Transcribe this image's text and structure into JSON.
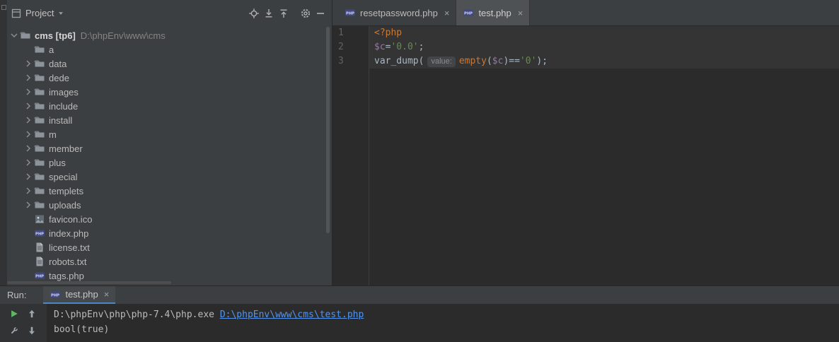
{
  "project_panel": {
    "title": "Project",
    "header_icons": [
      "locate-icon",
      "expand-all-icon",
      "collapse-all-icon",
      "settings-gear-icon",
      "hide-panel-icon"
    ],
    "tree": {
      "root": {
        "name": "cms [tp6]",
        "path": "D:\\phpEnv\\www\\cms"
      },
      "items": [
        {
          "label": "a",
          "type": "folder",
          "expandable": false
        },
        {
          "label": "data",
          "type": "folder",
          "expandable": true
        },
        {
          "label": "dede",
          "type": "folder",
          "expandable": true
        },
        {
          "label": "images",
          "type": "folder",
          "expandable": true
        },
        {
          "label": "include",
          "type": "folder",
          "expandable": true
        },
        {
          "label": "install",
          "type": "folder",
          "expandable": true
        },
        {
          "label": "m",
          "type": "folder",
          "expandable": true
        },
        {
          "label": "member",
          "type": "folder",
          "expandable": true
        },
        {
          "label": "plus",
          "type": "folder",
          "expandable": true
        },
        {
          "label": "special",
          "type": "folder",
          "expandable": true
        },
        {
          "label": "templets",
          "type": "folder",
          "expandable": true
        },
        {
          "label": "uploads",
          "type": "folder",
          "expandable": true
        },
        {
          "label": "favicon.ico",
          "type": "image",
          "expandable": false
        },
        {
          "label": "index.php",
          "type": "php",
          "expandable": false
        },
        {
          "label": "license.txt",
          "type": "text",
          "expandable": false
        },
        {
          "label": "robots.txt",
          "type": "text",
          "expandable": false
        },
        {
          "label": "tags.php",
          "type": "php",
          "expandable": false
        }
      ]
    }
  },
  "editor": {
    "close_glyph": "×",
    "tabs": [
      {
        "label": "resetpassword.php",
        "icon": "php-file-icon",
        "active": false
      },
      {
        "label": "test.php",
        "icon": "php-file-icon",
        "active": true
      }
    ],
    "code": {
      "lines": [
        {
          "number": "1",
          "highlighted": true,
          "tokens": [
            {
              "text": "<?php",
              "style": "keyword"
            }
          ]
        },
        {
          "number": "2",
          "highlighted": true,
          "tokens": [
            {
              "text": "$c",
              "style": "variable"
            },
            {
              "text": "=",
              "style": "plain"
            },
            {
              "text": "'0.0'",
              "style": "string"
            },
            {
              "text": ";",
              "style": "plain"
            }
          ]
        },
        {
          "number": "3",
          "highlighted": true,
          "tokens": [
            {
              "text": "var_dump(",
              "style": "plain"
            },
            {
              "text": "value:",
              "style": "hint"
            },
            {
              "text": "empty",
              "style": "keyword"
            },
            {
              "text": "(",
              "style": "plain"
            },
            {
              "text": "$c",
              "style": "variable"
            },
            {
              "text": ")==",
              "style": "plain"
            },
            {
              "text": "'0'",
              "style": "string"
            },
            {
              "text": ");",
              "style": "plain"
            }
          ]
        }
      ]
    }
  },
  "run_panel": {
    "label": "Run:",
    "tab": {
      "label": "test.php",
      "icon": "php-file-icon"
    },
    "toolbar_icons": [
      "run-play-icon",
      "arrow-up-icon",
      "build-wrench-icon",
      "arrow-down-icon"
    ],
    "console": {
      "lines": [
        {
          "segments": [
            {
              "text": "D:\\phpEnv\\php\\php-7.4\\php.exe ",
              "style": "plain"
            },
            {
              "text": "D:\\phpEnv\\www\\cms\\test.php",
              "style": "link"
            }
          ]
        },
        {
          "segments": [
            {
              "text": "bool(true)",
              "style": "plain"
            }
          ]
        }
      ]
    }
  },
  "colors": {
    "accent_link": "#5394ec",
    "run_tab_underline": "#4a88c7",
    "keyword": "#cc7832",
    "string": "#6a8759",
    "variable": "#9876aa",
    "play_green": "#5fb865"
  }
}
